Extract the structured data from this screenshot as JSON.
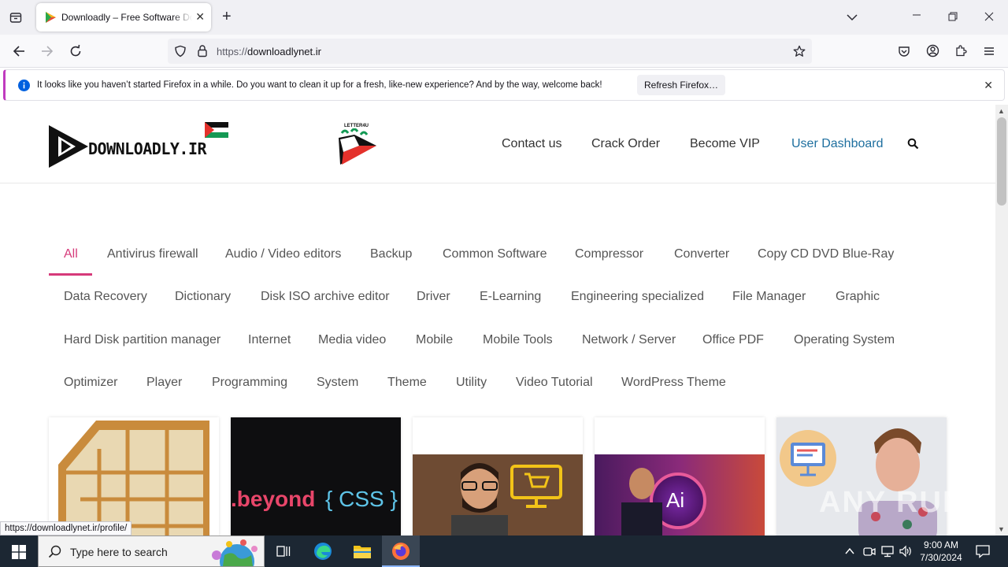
{
  "browser": {
    "tab_title": "Downloadly – Free Software Do",
    "url_scheme": "https://",
    "url_host": "downloadlynet.ir",
    "notification_text": "It looks like you haven’t started Firefox in a while. Do you want to clean it up for a fresh, like-new experience? And by the way, welcome back!",
    "refresh_label": "Refresh Firefox…",
    "status_url": "https://downloadlynet.ir/profile/"
  },
  "site": {
    "logo_text": "DOWNLOADLY.IR",
    "letter_logo_text": "LETTER4U",
    "nav": [
      "Contact us",
      "Crack Order",
      "Become VIP",
      "User Dashboard"
    ],
    "active_color": "#d63a7a",
    "link_color": "#1e6f9f"
  },
  "categories": [
    "All",
    "Antivirus firewall",
    "Audio / Video editors",
    "Backup",
    "Common Software",
    "Compressor",
    "Converter",
    "Copy CD DVD Blue-Ray",
    "Data Recovery",
    "Dictionary",
    "Disk ISO archive editor",
    "Driver",
    "E-Learning",
    "Engineering specialized",
    "File Manager",
    "Graphic",
    "Hard Disk partition manager",
    "Internet",
    "Media video",
    "Mobile",
    "Mobile Tools",
    "Network / Server",
    "Office PDF",
    "Operating System",
    "Optimizer",
    "Player",
    "Programming",
    "System",
    "Theme",
    "Utility",
    "Video Tutorial",
    "WordPress Theme"
  ],
  "cards": {
    "card2_text_a": ".beyond",
    "card2_text_b": "{ CSS }",
    "card4_text": "Ai",
    "watermark": "ANY RUN"
  },
  "taskbar": {
    "search_placeholder": "Type here to search",
    "time": "9:00 AM",
    "date": "7/30/2024"
  }
}
